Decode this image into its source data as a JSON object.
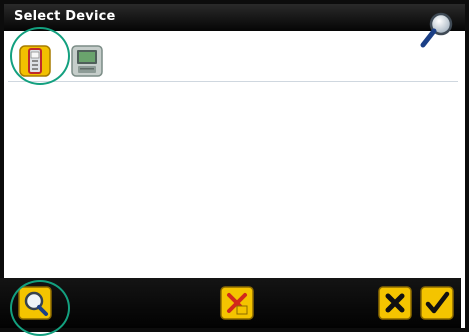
{
  "window": {
    "title": "Select Device"
  },
  "toolbar": {
    "search_icon": "magnifier-icon",
    "devices": [
      {
        "name": "handheld-device-icon",
        "selected": true,
        "accent": "#f2c100"
      },
      {
        "name": "computer-device-icon",
        "selected": false,
        "accent": "#7b8c86"
      }
    ]
  },
  "footer": {
    "find_button_icon": "magnifier-icon",
    "delete_button_icon": "red-x-icon",
    "cancel_button_icon": "black-x-icon",
    "ok_button_icon": "checkmark-icon"
  },
  "colors": {
    "highlight_ring": "#13a07f",
    "button_yellow": "#f4c400"
  }
}
